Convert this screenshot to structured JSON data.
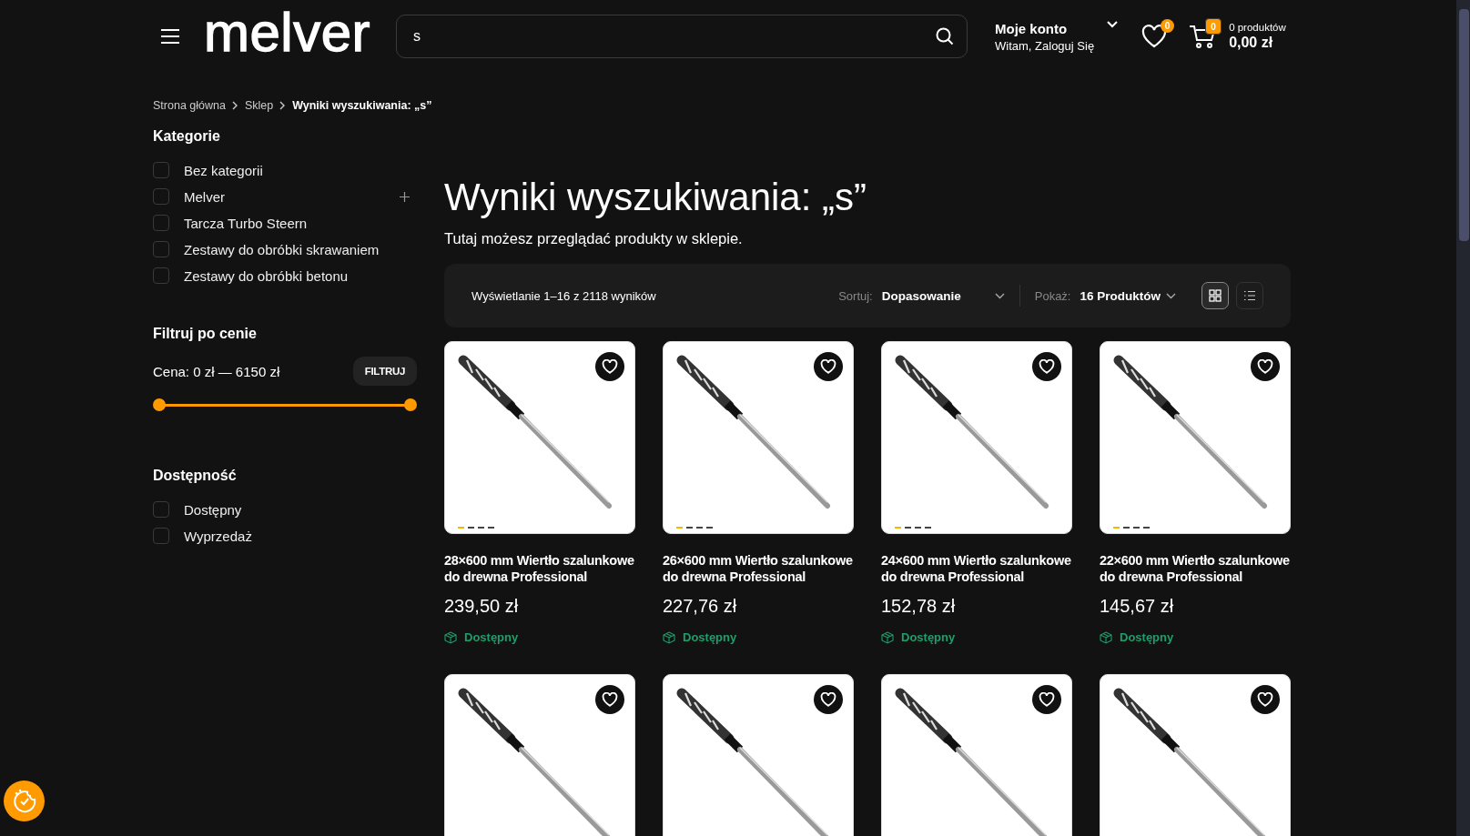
{
  "header": {
    "logo": "melver",
    "search": {
      "value": "s"
    },
    "account": {
      "title": "Moje konto",
      "subtitle": "Witam, Zaloguj Się"
    },
    "wishlist_count": "0",
    "cart": {
      "count": "0",
      "items_label": "0 produktów",
      "total": "0,00 zł"
    }
  },
  "breadcrumb": [
    {
      "label": "Strona główna",
      "current": false
    },
    {
      "label": "Sklep",
      "current": false
    },
    {
      "label": "Wyniki wyszukiwania: „s”",
      "current": true
    }
  ],
  "sidebar": {
    "categories_title": "Kategorie",
    "categories": [
      {
        "label": "Bez kategorii",
        "checked": false,
        "expandable": false
      },
      {
        "label": "Melver",
        "checked": false,
        "expandable": true
      },
      {
        "label": "Tarcza Turbo Steern",
        "checked": false,
        "expandable": false
      },
      {
        "label": "Zestawy do obróbki skrawaniem",
        "checked": false,
        "expandable": false
      },
      {
        "label": "Zestawy do obróbki betonu",
        "checked": false,
        "expandable": false
      }
    ],
    "price_title": "Filtruj po cenie",
    "price_label": "Cena: 0 zł — 6150 zł",
    "filter_button": "FILTRUJ",
    "price_min": {
      "level": 0
    },
    "price_max": {
      "level": 1
    },
    "availability_title": "Dostępność",
    "availability": [
      {
        "label": "Dostępny",
        "checked": false
      },
      {
        "label": "Wyprzedaż",
        "checked": false
      }
    ]
  },
  "main": {
    "title": "Wyniki wyszukiwania: „s”",
    "subtitle": "Tutaj możesz przeglądać produkty w sklepie.",
    "toolbar": {
      "result_count": "Wyświetlanie 1–16 z 2118 wyników",
      "sort_label": "Sortuj:",
      "sort_value": "Dopasowanie",
      "show_label": "Pokaż:",
      "show_value": "16 Produktów",
      "views": [
        {
          "kind": "grid",
          "selected": true
        },
        {
          "kind": "list",
          "selected": false
        }
      ]
    },
    "products": [
      {
        "name": "28×600 mm Wiertło szalunkowe do drewna Professional",
        "price": "239,50 zł",
        "availability": "Dostępny",
        "wishlisted": false,
        "slides": [
          {
            "selected": true
          },
          {
            "selected": false
          },
          {
            "selected": false
          },
          {
            "selected": false
          }
        ]
      },
      {
        "name": "26×600 mm Wiertło szalunkowe do drewna Professional",
        "price": "227,76 zł",
        "availability": "Dostępny",
        "wishlisted": false,
        "slides": [
          {
            "selected": true
          },
          {
            "selected": false
          },
          {
            "selected": false
          },
          {
            "selected": false
          }
        ]
      },
      {
        "name": "24×600 mm Wiertło szalunkowe do drewna Professional",
        "price": "152,78 zł",
        "availability": "Dostępny",
        "wishlisted": false,
        "slides": [
          {
            "selected": true
          },
          {
            "selected": false
          },
          {
            "selected": false
          },
          {
            "selected": false
          }
        ]
      },
      {
        "name": "22×600 mm Wiertło szalunkowe do drewna Professional",
        "price": "145,67 zł",
        "availability": "Dostępny",
        "wishlisted": false,
        "slides": [
          {
            "selected": true
          },
          {
            "selected": false
          },
          {
            "selected": false
          },
          {
            "selected": false
          }
        ]
      },
      {
        "wishlisted": false
      },
      {
        "wishlisted": false
      },
      {
        "wishlisted": false
      },
      {
        "wishlisted": false
      }
    ]
  }
}
